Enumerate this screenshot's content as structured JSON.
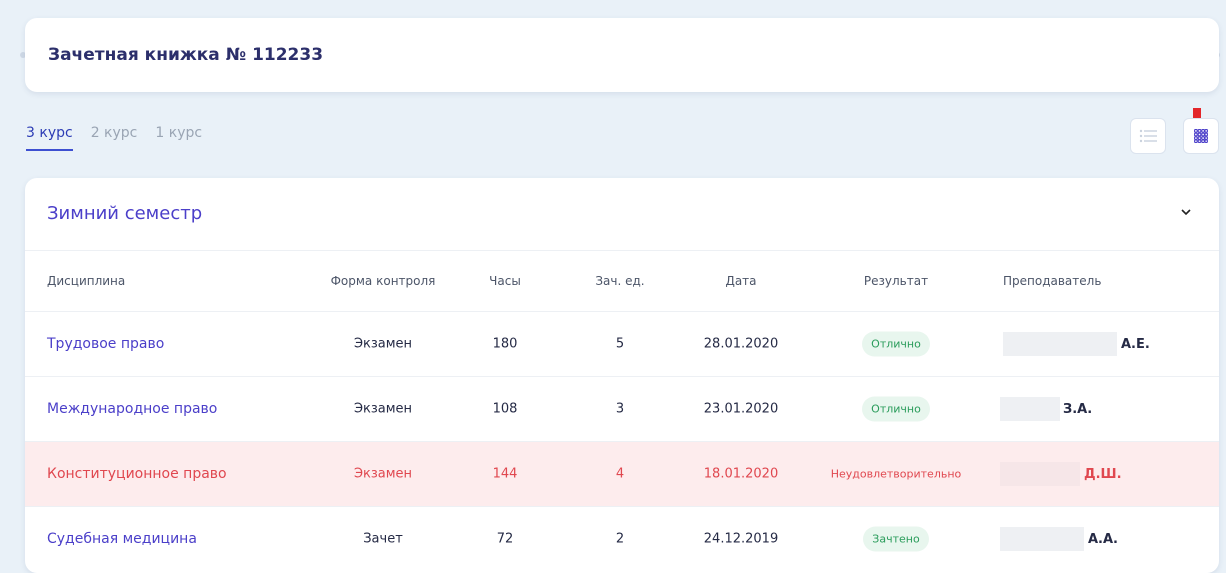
{
  "header": {
    "title": "Зачетная книжка № 112233"
  },
  "tabs": [
    {
      "label": "3 курс",
      "active": true
    },
    {
      "label": "2 курс",
      "active": false
    },
    {
      "label": "1 курс",
      "active": false
    }
  ],
  "view_toggle": {
    "list_icon": "list-icon",
    "grid_icon": "grid-icon",
    "annotation_icon": "red-down-arrow-icon"
  },
  "semester": {
    "title": "Зимний семестр",
    "columns": {
      "discipline": "Дисциплина",
      "form": "Форма контроля",
      "hours": "Часы",
      "credits": "Зач. ед.",
      "date": "Дата",
      "result": "Результат",
      "teacher": "Преподаватель"
    },
    "rows": [
      {
        "discipline": "Трудовое право",
        "form": "Экзамен",
        "hours": "180",
        "credits": "5",
        "date": "28.01.2020",
        "result": "Отлично",
        "teacher_initials": "А.Е.",
        "status": "ok"
      },
      {
        "discipline": "Международное право",
        "form": "Экзамен",
        "hours": "108",
        "credits": "3",
        "date": "23.01.2020",
        "result": "Отлично",
        "teacher_initials": "З.А.",
        "status": "ok"
      },
      {
        "discipline": "Конституционное право",
        "form": "Экзамен",
        "hours": "144",
        "credits": "4",
        "date": "18.01.2020",
        "result": "Неудовлетворительно",
        "teacher_initials": "Д.Ш.",
        "status": "failed"
      },
      {
        "discipline": "Судебная медицина",
        "form": "Зачет",
        "hours": "72",
        "credits": "2",
        "date": "24.12.2019",
        "result": "Зачтено",
        "teacher_initials": "А.А.",
        "status": "ok"
      }
    ]
  },
  "colors": {
    "accent": "#4b3fc9",
    "fail": "#e0474f",
    "fail_bg": "#fdeced",
    "success": "#2a9c5b",
    "success_bg": "#e8f6ee",
    "page_bg": "#e9f1f8"
  }
}
